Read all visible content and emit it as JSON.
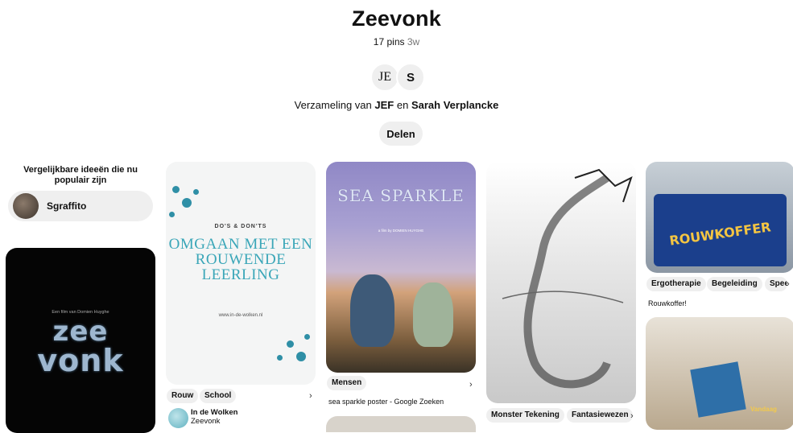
{
  "board": {
    "title": "Zeevonk",
    "pin_count": "17 pins",
    "age": "3w",
    "collaborators": [
      {
        "initials": "JE"
      },
      {
        "initials": "S"
      }
    ],
    "collab_prefix": "Verzameling van",
    "collab_name1": "JEF",
    "collab_and": "en",
    "collab_name2": "Sarah Verplancke",
    "share_label": "Delen"
  },
  "sidebar": {
    "heading": "Vergelijkbare ideeën die nu populair zijn",
    "suggestion": "Sgraffito"
  },
  "film_poster": {
    "credit": "Een film van Domien Huyghe",
    "title_line1": "zee",
    "title_line2": "vonk"
  },
  "pins": [
    {
      "subtitle": "DO'S & DON'TS",
      "title": "OMGAAN MET EEN ROUWENDE LEERLING",
      "url": "www.in-de-wolken.nl",
      "tags": [
        "Rouw",
        "School"
      ],
      "source_name": "In de Wolken",
      "source_board": "Zeevonk"
    },
    {
      "poster_title": "SEA SPARKLE",
      "poster_credit": "a film by DOMIEN HUYGHE",
      "tags": [
        "Mensen"
      ],
      "caption": "sea sparkle poster - Google Zoeken"
    },
    {
      "tags": [
        "Monster Tekening",
        "Fantasiewezen"
      ]
    },
    {
      "box_text": "ROUWKOFFER",
      "tags": [
        "Ergotherapie",
        "Begeleiding",
        "Spee"
      ],
      "caption": "Rouwkoffer!"
    },
    {
      "image_text": "Vandaag"
    }
  ]
}
